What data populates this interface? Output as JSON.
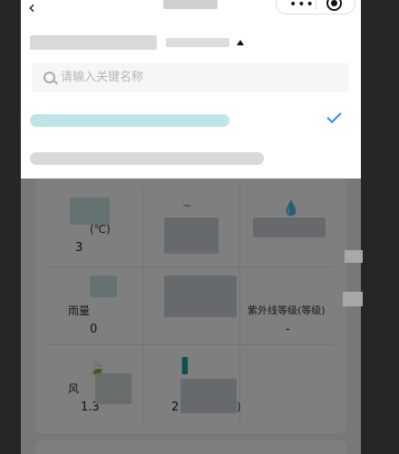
{
  "nav": {
    "back_icon": "chevron-left-icon",
    "capsule_dots": "•••",
    "capsule_target_icon": "target-icon"
  },
  "dropdown": {
    "search": {
      "placeholder": "请输入关键名称",
      "value": ""
    },
    "options": [
      {
        "selected": true,
        "check_icon": "check-icon"
      },
      {
        "selected": false
      }
    ]
  },
  "background": {
    "cells": [
      {
        "label": "(℃)",
        "value": "3"
      },
      {
        "label": "",
        "value": ""
      },
      {
        "label": "",
        "value": ""
      },
      {
        "label": "雨量",
        "value": "0"
      },
      {
        "label": "",
        "value": ""
      },
      {
        "label": "紫外线等级(等级)",
        "value": "-"
      },
      {
        "label": "风",
        "value": "1.3"
      },
      {
        "label": "",
        "value": "2"
      },
      {
        "label": ")",
        "value": ""
      }
    ]
  },
  "colors": {
    "accent": "#2e8bf0",
    "teal": "#17a2a0",
    "overlay": "rgba(0,0,0,0.5)"
  }
}
